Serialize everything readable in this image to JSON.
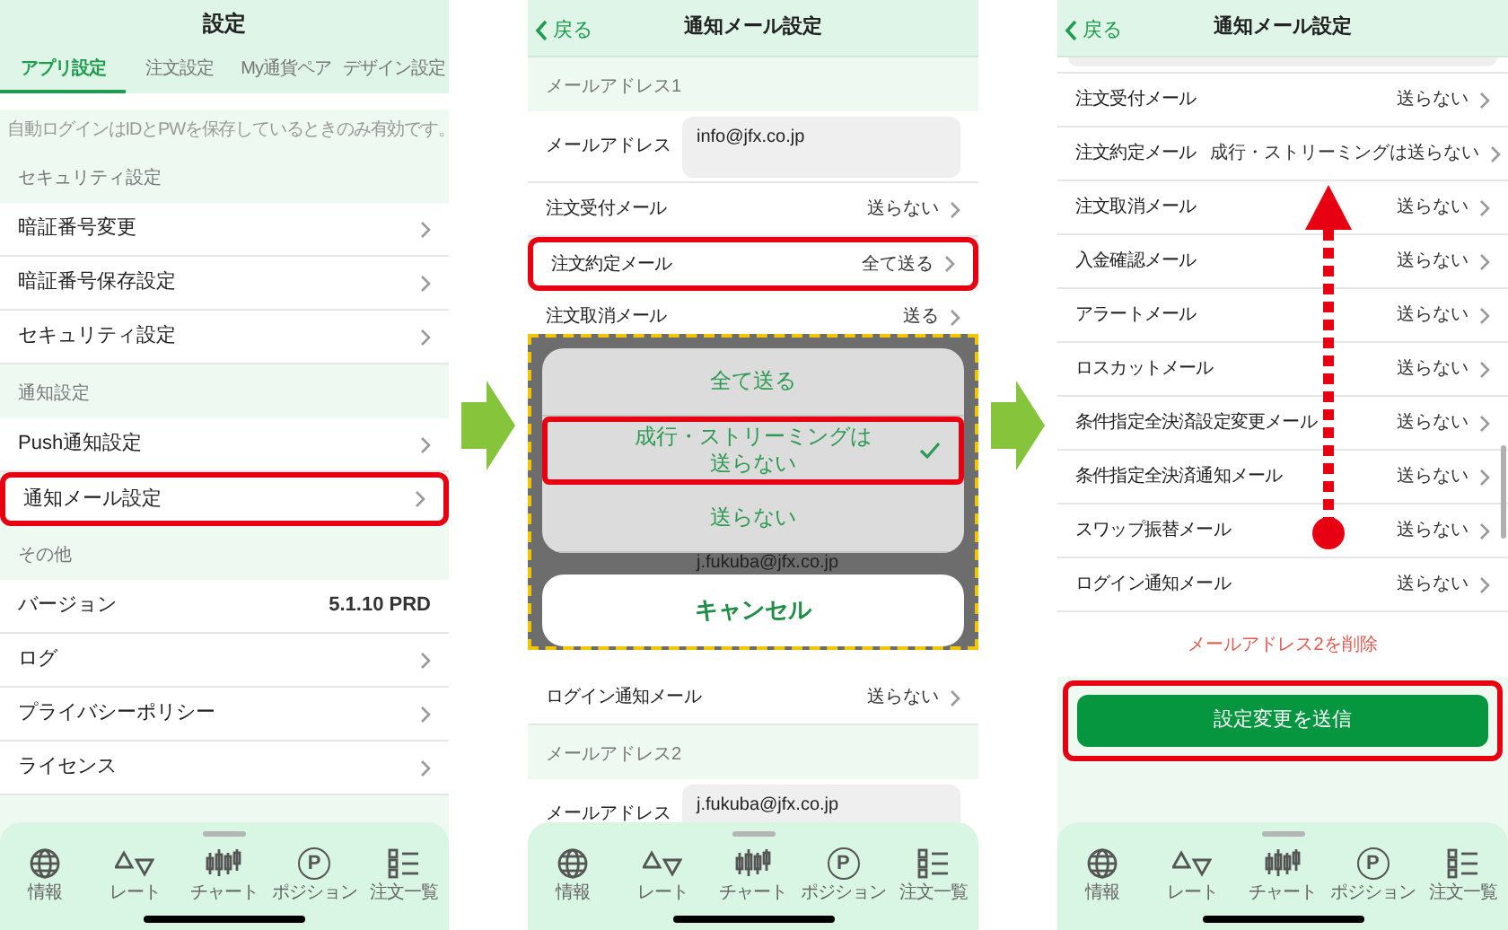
{
  "screens": [
    {
      "kind": "settings",
      "title": "設定",
      "tabs": [
        {
          "label": "アプリ設定",
          "selected": true
        },
        {
          "label": "注文設定",
          "selected": false
        },
        {
          "label": "My通貨ペア",
          "selected": false
        },
        {
          "label": "デザイン設定",
          "selected": false
        }
      ],
      "blocks": [
        {
          "kind": "note",
          "text": "自動ログインはIDとPWを保存しているときのみ有効です。"
        },
        {
          "kind": "section",
          "text": "セキュリティ設定"
        },
        {
          "kind": "row",
          "label": "暗証番号変更",
          "chevron": true,
          "highlighted": false
        },
        {
          "kind": "row",
          "label": "暗証番号保存設定",
          "chevron": true,
          "highlighted": false
        },
        {
          "kind": "row",
          "label": "セキュリティ設定",
          "chevron": true,
          "highlighted": false
        },
        {
          "kind": "section",
          "text": "通知設定"
        },
        {
          "kind": "row",
          "label": "Push通知設定",
          "chevron": true,
          "highlighted": false
        },
        {
          "kind": "row",
          "label": "通知メール設定",
          "chevron": true,
          "highlighted": true
        },
        {
          "kind": "section",
          "text": "その他"
        },
        {
          "kind": "row",
          "label": "バージョン",
          "value": "5.1.10 PRD",
          "chevron": false,
          "highlighted": false
        },
        {
          "kind": "row",
          "label": "ログ",
          "chevron": true,
          "highlighted": false
        },
        {
          "kind": "row",
          "label": "プライバシーポリシー",
          "chevron": true,
          "highlighted": false
        },
        {
          "kind": "row",
          "label": "ライセンス",
          "chevron": true,
          "highlighted": false
        }
      ],
      "tab_bar": [
        {
          "kind": "globe",
          "label": "情報"
        },
        {
          "kind": "rate",
          "label": "レート"
        },
        {
          "kind": "candles",
          "label": "チャート"
        },
        {
          "kind": "position",
          "glyph": "P",
          "label": "ポジション"
        },
        {
          "kind": "list",
          "label": "注文一覧"
        }
      ]
    },
    {
      "kind": "mail",
      "back": "戻る",
      "title": "通知メール設定",
      "blocks": [
        {
          "kind": "section",
          "text": "メールアドレス1"
        },
        {
          "kind": "email",
          "label": "メールアドレス",
          "value": "info@jfx.co.jp"
        },
        {
          "kind": "row",
          "label": "注文受付メール",
          "value": "送らない",
          "chevron": true,
          "highlighted": false
        },
        {
          "kind": "row",
          "label": "注文約定メール",
          "value": "全て送る",
          "chevron": true,
          "highlighted": true
        },
        {
          "kind": "row",
          "label": "注文取消メール",
          "value": "送る",
          "chevron": true,
          "highlighted": false
        },
        {
          "kind": "sheet",
          "options": [
            {
              "label": "全て送る",
              "selected": false
            },
            {
              "label": "成行・ストリーミングは送らない",
              "selected": true
            },
            {
              "label": "送らない",
              "selected": false
            }
          ],
          "behind_text": "j.fukuba@jfx.co.jp",
          "cancel": "キャンセル"
        },
        {
          "kind": "row",
          "label": "ログイン通知メール",
          "value": "送らない",
          "chevron": true,
          "highlighted": false
        },
        {
          "kind": "section",
          "text": "メールアドレス2"
        },
        {
          "kind": "email",
          "label": "メールアドレス",
          "value": "j.fukuba@jfx.co.jp"
        }
      ],
      "tab_bar": [
        {
          "kind": "globe",
          "label": "情報"
        },
        {
          "kind": "rate",
          "label": "レート"
        },
        {
          "kind": "candles",
          "label": "チャート"
        },
        {
          "kind": "position",
          "glyph": "P",
          "label": "ポジション"
        },
        {
          "kind": "list",
          "label": "注文一覧"
        }
      ]
    },
    {
      "kind": "mail",
      "back": "戻る",
      "title": "通知メール設定",
      "blocks": [
        {
          "kind": "field_end"
        },
        {
          "kind": "row",
          "label": "注文受付メール",
          "value": "送らない",
          "chevron": true,
          "highlighted": false
        },
        {
          "kind": "row",
          "label": "注文約定メール",
          "value": "成行・ストリーミングは送らない",
          "chevron": true,
          "highlighted": false
        },
        {
          "kind": "row",
          "label": "注文取消メール",
          "value": "送らない",
          "chevron": true,
          "highlighted": false
        },
        {
          "kind": "row",
          "label": "入金確認メール",
          "value": "送らない",
          "chevron": true,
          "highlighted": false
        },
        {
          "kind": "row",
          "label": "アラートメール",
          "value": "送らない",
          "chevron": true,
          "highlighted": false
        },
        {
          "kind": "row",
          "label": "ロスカットメール",
          "value": "送らない",
          "chevron": true,
          "highlighted": false
        },
        {
          "kind": "row",
          "label": "条件指定全決済設定変更メール",
          "value": "送らない",
          "chevron": true,
          "highlighted": false
        },
        {
          "kind": "row",
          "label": "条件指定全決済通知メール",
          "value": "送らない",
          "chevron": true,
          "highlighted": false
        },
        {
          "kind": "row",
          "label": "スワップ振替メール",
          "value": "送らない",
          "chevron": true,
          "highlighted": false
        },
        {
          "kind": "row",
          "label": "ログイン通知メール",
          "value": "送らない",
          "chevron": true,
          "highlighted": false
        },
        {
          "kind": "delete_link",
          "text": "メールアドレス2を削除"
        },
        {
          "kind": "submit",
          "text": "設定変更を送信",
          "highlighted": true
        }
      ],
      "scroll_arrow": true,
      "tab_bar": [
        {
          "kind": "globe",
          "label": "情報"
        },
        {
          "kind": "rate",
          "label": "レート"
        },
        {
          "kind": "candles",
          "label": "チャート"
        },
        {
          "kind": "position",
          "glyph": "P",
          "label": "ポジション"
        },
        {
          "kind": "list",
          "label": "注文一覧"
        }
      ]
    }
  ]
}
